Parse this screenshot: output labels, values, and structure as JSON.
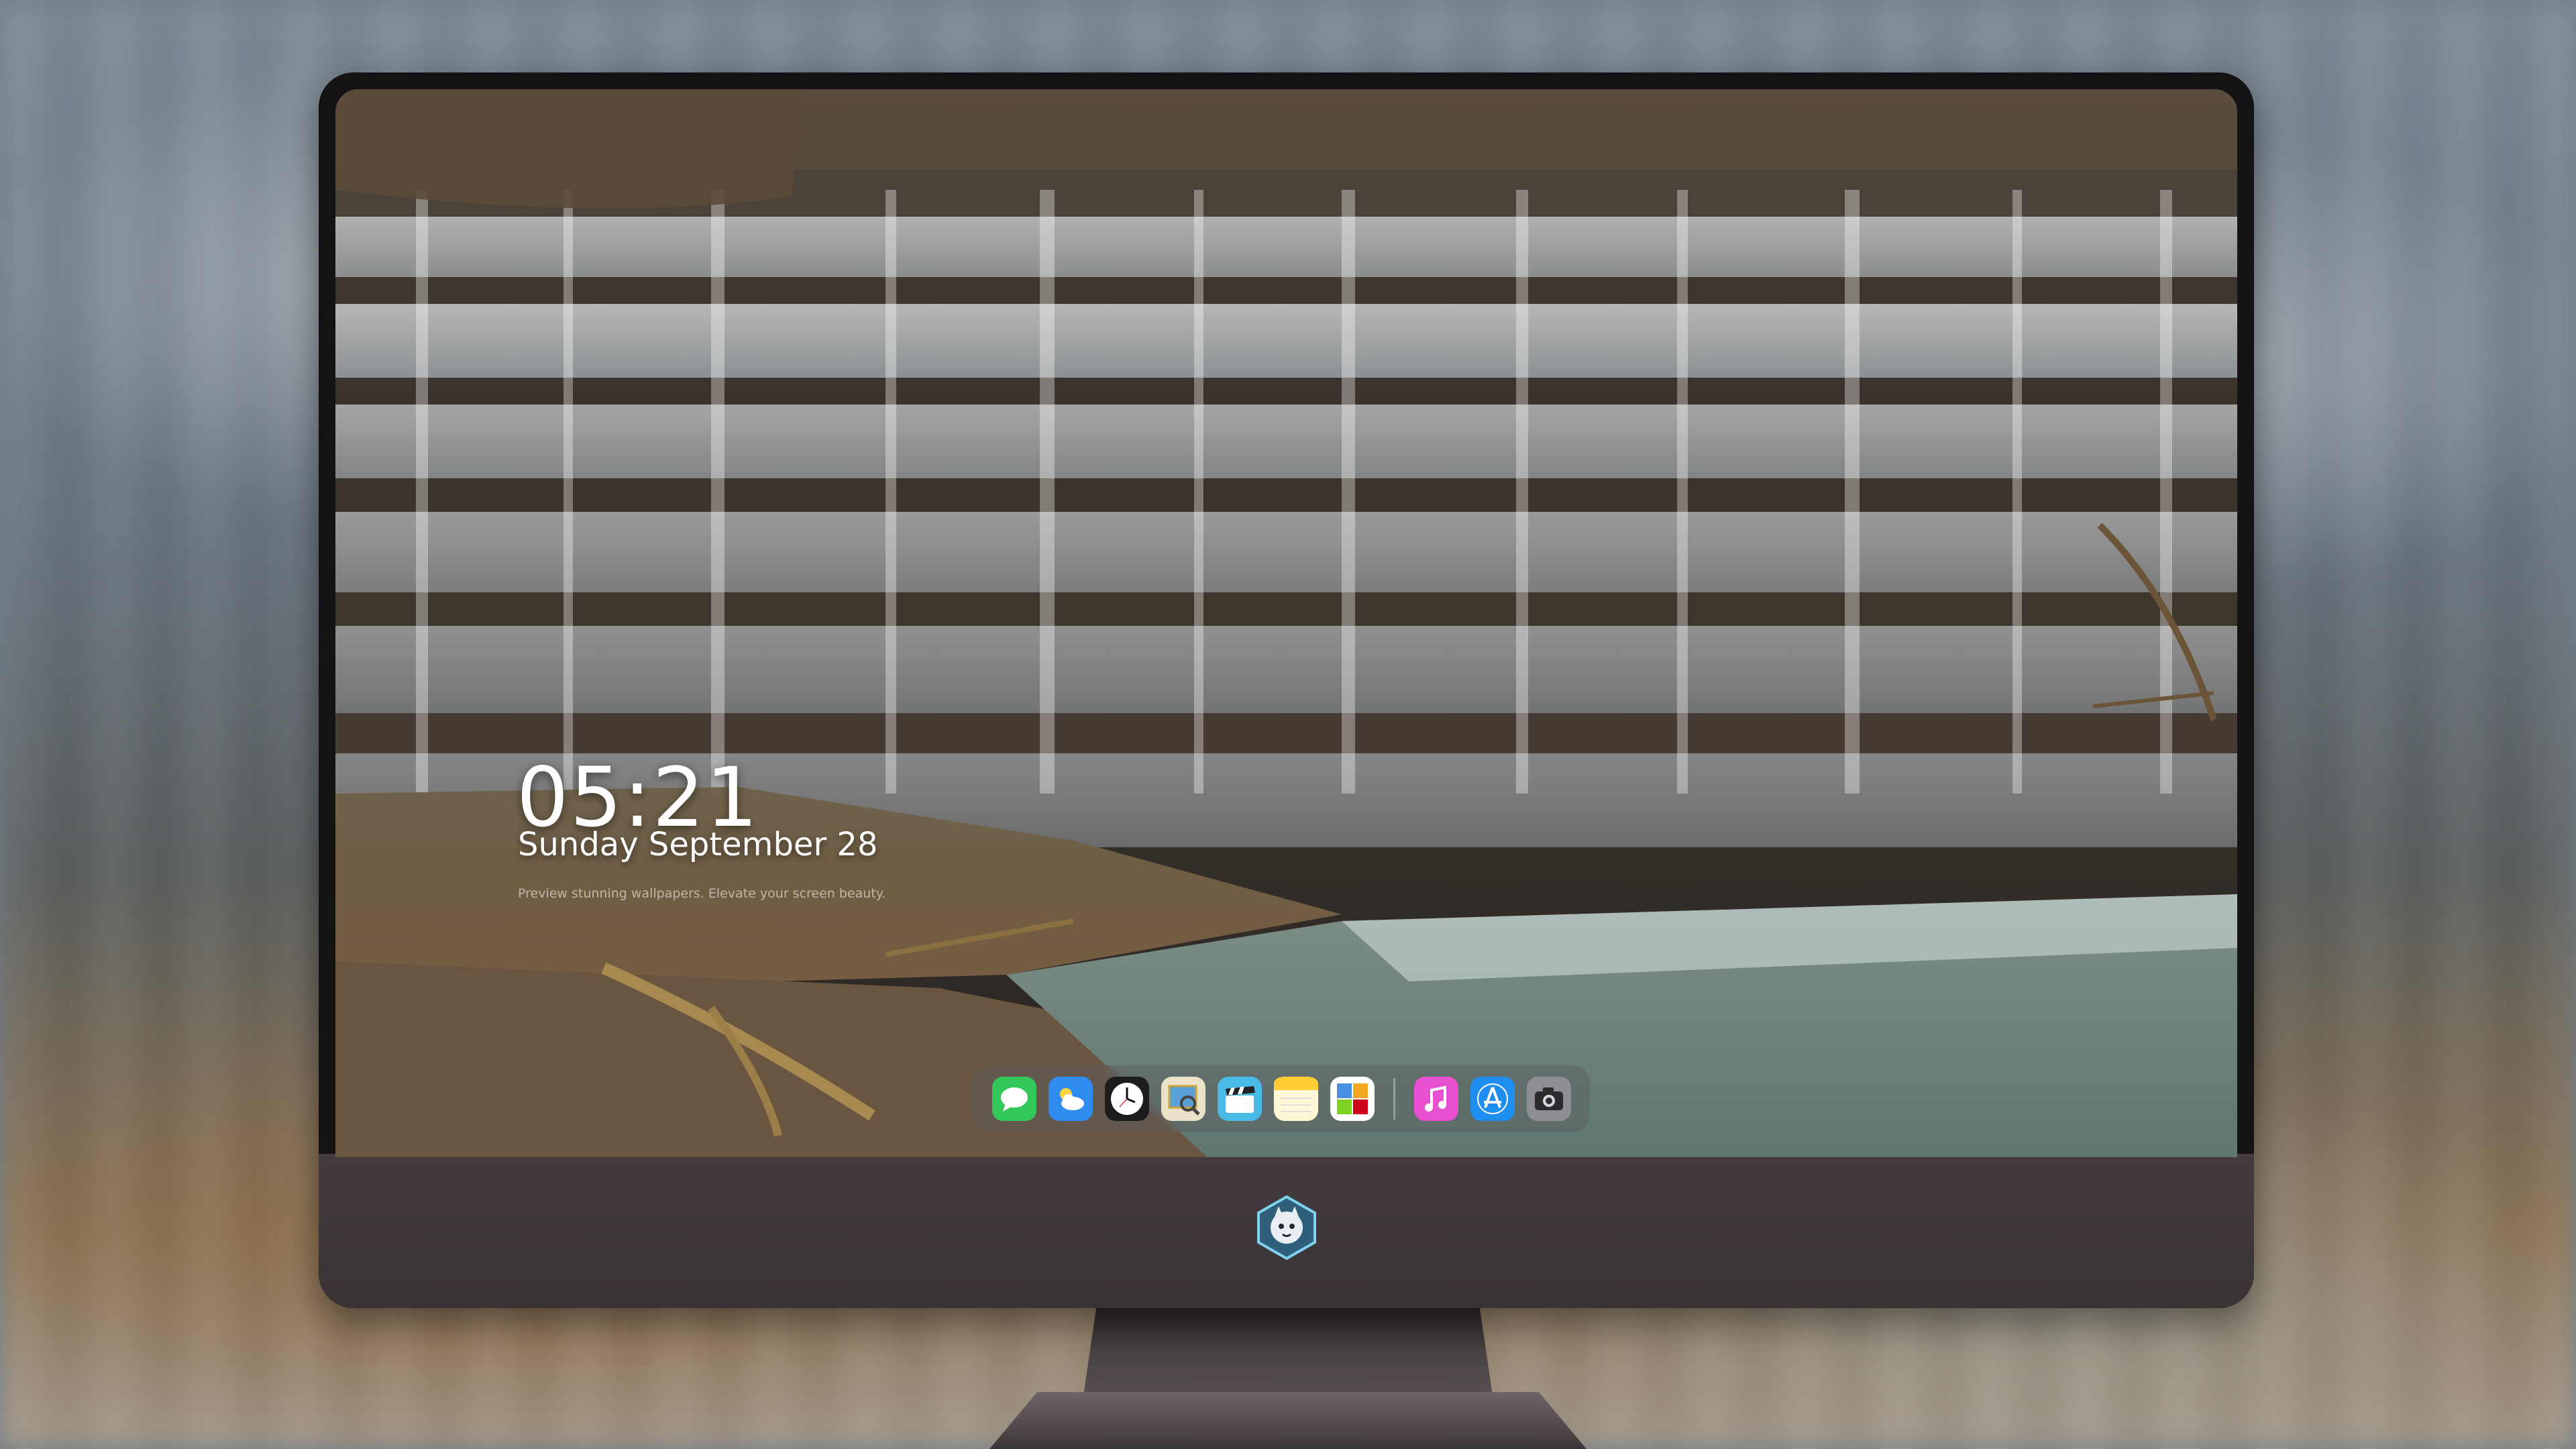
{
  "lockscreen": {
    "time": "05:21",
    "date": "Sunday September  28",
    "caption": "Preview stunning wallpapers. Elevate your screen beauty."
  },
  "dock": {
    "apps": [
      {
        "name": "messages",
        "icon": "message-bubble-icon",
        "color": "#34c759"
      },
      {
        "name": "weather",
        "icon": "cloud-icon",
        "color": "#2f8cf0"
      },
      {
        "name": "clock",
        "icon": "clock-icon",
        "color": "#1c1c1e"
      },
      {
        "name": "preview",
        "icon": "magnifier-photo-icon",
        "color": "#e0c24a"
      },
      {
        "name": "videos",
        "icon": "clapperboard-icon",
        "color": "#49b9e6"
      },
      {
        "name": "notes",
        "icon": "notes-icon",
        "color": "#ffd54a"
      },
      {
        "name": "photos",
        "icon": "photo-grid-icon",
        "color": "#ffffff"
      },
      {
        "name": "music",
        "icon": "music-note-icon",
        "color": "#e94fd1"
      },
      {
        "name": "app-store",
        "icon": "app-store-icon",
        "color": "#1f8ef1"
      },
      {
        "name": "camera",
        "icon": "camera-icon",
        "color": "#8e8e93"
      }
    ]
  },
  "colors": {
    "bezel": "#141214",
    "chin": "#3a3336",
    "text": "#ffffff"
  }
}
